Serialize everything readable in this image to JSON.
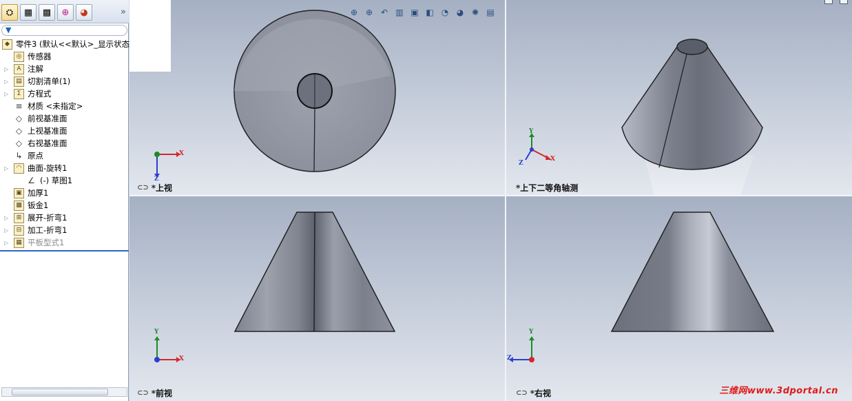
{
  "feature_manager": {
    "tabs": [
      {
        "icon": "feature-tree-icon"
      },
      {
        "icon": "property-manager-icon"
      },
      {
        "icon": "configuration-manager-icon"
      },
      {
        "icon": "dimxpert-icon"
      },
      {
        "icon": "display-manager-icon"
      }
    ],
    "expand_glyph": "»",
    "tree": [
      {
        "label": "零件3  (默认<<默认>_显示状态",
        "icon": "part-icon",
        "indent": 0,
        "expandable": false,
        "dim": false
      },
      {
        "label": "传感器",
        "icon": "sensor-icon",
        "indent": 1,
        "expandable": false,
        "dim": false
      },
      {
        "label": "注解",
        "icon": "annotation-icon",
        "indent": 1,
        "expandable": true,
        "dim": false
      },
      {
        "label": "切割清单(1)",
        "icon": "cut-list-icon",
        "indent": 1,
        "expandable": true,
        "dim": false
      },
      {
        "label": "方程式",
        "icon": "equation-icon",
        "indent": 1,
        "expandable": true,
        "dim": false
      },
      {
        "label": "材质 <未指定>",
        "icon": "material-icon",
        "indent": 1,
        "expandable": false,
        "dim": false
      },
      {
        "label": "前视基准面",
        "icon": "plane-icon",
        "indent": 1,
        "expandable": false,
        "dim": false
      },
      {
        "label": "上视基准面",
        "icon": "plane-icon",
        "indent": 1,
        "expandable": false,
        "dim": false
      },
      {
        "label": "右视基准面",
        "icon": "plane-icon",
        "indent": 1,
        "expandable": false,
        "dim": false
      },
      {
        "label": "原点",
        "icon": "origin-icon",
        "indent": 1,
        "expandable": false,
        "dim": false
      },
      {
        "label": "曲面-旋转1",
        "icon": "revolve-surface-icon",
        "indent": 1,
        "expandable": true,
        "dim": false
      },
      {
        "label": "(-) 草图1",
        "icon": "sketch-icon",
        "indent": 2,
        "expandable": false,
        "dim": false
      },
      {
        "label": "加厚1",
        "icon": "thicken-icon",
        "indent": 1,
        "expandable": false,
        "dim": false
      },
      {
        "label": "钣金1",
        "icon": "sheet-metal-icon",
        "indent": 1,
        "expandable": false,
        "dim": false
      },
      {
        "label": "展开-折弯1",
        "icon": "flatten-bends-icon",
        "indent": 1,
        "expandable": true,
        "dim": false
      },
      {
        "label": "加工-折弯1",
        "icon": "process-bends-icon",
        "indent": 1,
        "expandable": true,
        "dim": false
      },
      {
        "label": "平板型式1",
        "icon": "flat-pattern-icon",
        "indent": 1,
        "expandable": true,
        "dim": true
      }
    ]
  },
  "hud_toolbar": [
    {
      "icon": "zoom-to-fit-icon",
      "glyph": "⊕"
    },
    {
      "icon": "zoom-to-area-icon",
      "glyph": "⊕"
    },
    {
      "icon": "previous-view-icon",
      "glyph": "↶"
    },
    {
      "icon": "section-view-icon",
      "glyph": "▥"
    },
    {
      "icon": "view-orientation-icon",
      "glyph": "▣"
    },
    {
      "icon": "display-style-icon",
      "glyph": "◧"
    },
    {
      "icon": "hide-show-items-icon",
      "glyph": "◔"
    },
    {
      "icon": "edit-appearance-icon",
      "glyph": "◕"
    },
    {
      "icon": "apply-scene-icon",
      "glyph": "✺"
    },
    {
      "icon": "view-settings-icon",
      "glyph": "▤"
    }
  ],
  "viewports": {
    "top": {
      "label": "*上视"
    },
    "iso": {
      "label": "*上下二等角轴测"
    },
    "front": {
      "label": "*前视"
    },
    "right": {
      "label": "*右视"
    }
  },
  "triad": {
    "x": "X",
    "y": "Y",
    "z": "Z"
  },
  "watermark": "三维网www.3dportal.cn",
  "colors": {
    "x_axis": "#d6262a",
    "y_axis": "#1e8a2a",
    "z_axis": "#2b3fcf",
    "selection": "#2b66c4"
  }
}
